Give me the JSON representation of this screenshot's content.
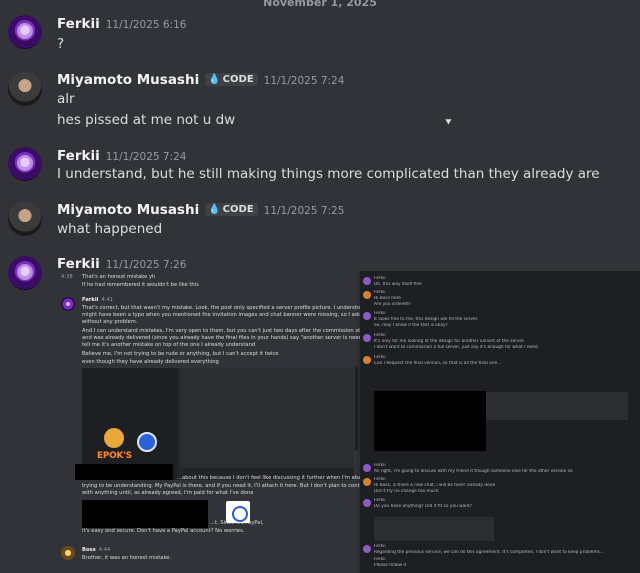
{
  "divider": {
    "date": "November 1, 2025"
  },
  "messages": [
    {
      "id": "m1",
      "author": "Ferkii",
      "timestamp": "11/1/2025 6:16",
      "text": "?"
    },
    {
      "id": "m2",
      "author": "Miyamoto Musashi",
      "tag": "CODE",
      "timestamp": "11/1/2025 7:24",
      "lines": [
        "alr",
        "hes pissed at me not u dw"
      ]
    },
    {
      "id": "m3",
      "author": "Ferkii",
      "timestamp": "11/1/2025 7:24",
      "text": "I understand, but he still making things more complicated than they already are"
    },
    {
      "id": "m4",
      "author": "Miyamoto Musashi",
      "tag": "CODE",
      "timestamp": "11/1/2025 7:25",
      "text": "what happened"
    },
    {
      "id": "m5",
      "author": "Ferkii",
      "timestamp": "11/1/2025 7:26"
    }
  ],
  "attachment": {
    "left": {
      "top_lines": [
        "That's an honest mistake yh",
        "If he had remembered it wouldn't be like this"
      ],
      "top_ts": "4:38",
      "ferkii_name": "Ferkii",
      "ferkii_ts": "4:41",
      "para1": [
        "That's correct, but that wasn't my mistake. Look, the post only specified a server profile picture. I understood it",
        "might have been a typo when you mentioned the invitation images and chat banner were missing, so I added them",
        "without any problem."
      ],
      "para2": [
        "And I can understand mistakes, I'm very open to them, but you can't just two days after the commission started",
        "and was already delivered (since you already have the final files in your hands) say \"another server is needed\" and",
        "tell me it's another mistake on top of the one I already understand"
      ],
      "para3": [
        "Believe me, I'm not trying to be rude or anything, but I can't accept it twice",
        "even though they have already delivered everything"
      ],
      "logo_text": "EPOK'S",
      "para4": [
        "...about this because I don't feel like discussing it further when I'm also",
        "trying to be understanding. My PayPal is there, and if you need it, I'll attach it here. But I don't plan to continue",
        "with anything until, as already agreed, I'm paid for what I've done"
      ],
      "paypal_line": "...t. Since it's PayPal,",
      "paypal_line2": "it's easy and secure. Don't have a PayPal account? No worries.",
      "boss_name": "Boss",
      "boss_ts": "4:44",
      "boss_text": "Brother, it was an honest mistake."
    },
    "right_lines": [
      "Ferkii",
      "Ok, this way itself fine",
      "Ferkii",
      "Hi Boss here",
      "Are you ordered?",
      "Ferkii",
      "It looks fine to me, this design will fill the server.",
      "So, may I know if the text is okay?",
      "Ferkii",
      "It's only for me looking at the design for another variant of the server.",
      "I don't want to commission a full server, just say it's enough for what I need.",
      "Ferkii",
      "Can I Request the final version, so that is all the final one..."
    ],
    "right_lines_b": [
      "Ferkii",
      "All right, I'm going to discuss with my friend it though someone else for the other version so",
      "Ferkii",
      "Hi Boss, is there a new chat, i will be here! already done",
      "Don't try no change too much",
      "Ferkii",
      "Do you have anything? Did it fit so you want?",
      "Ferkii",
      "Regarding the previous service, we can do this agreement. It's completed. I don't want to keep problems...",
      "Ferkii",
      "Please follow it"
    ]
  }
}
